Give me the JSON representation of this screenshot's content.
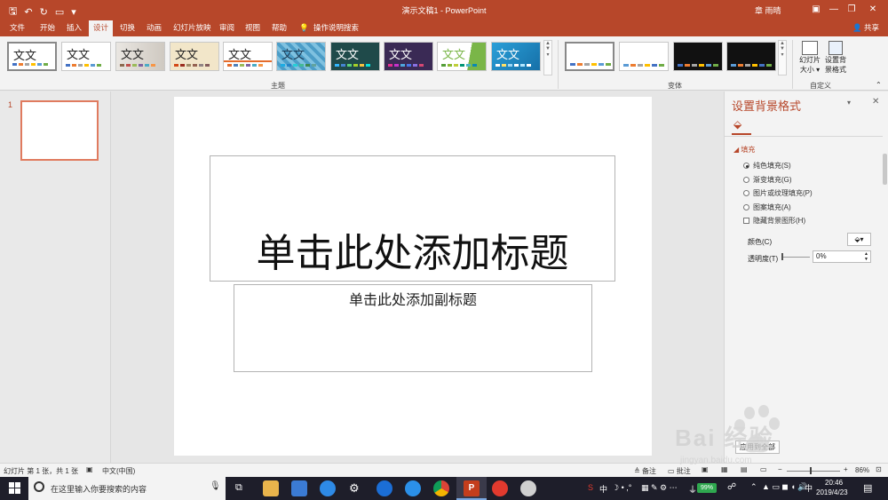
{
  "titlebar": {
    "document_title": "演示文稿1 - PowerPoint",
    "user": "章 雨晴",
    "minimize": "—",
    "restore": "❐",
    "close": "✕"
  },
  "tabs": [
    "文件",
    "开始",
    "插入",
    "设计",
    "切换",
    "动画",
    "幻灯片放映",
    "审阅",
    "视图",
    "帮助"
  ],
  "active_tab": "设计",
  "tell_me": "操作说明搜索",
  "share": "共享",
  "ribbon": {
    "themes_group": "主题",
    "variants_group": "变体",
    "customize_group": "自定义",
    "theme_label": "文文",
    "theme_label_short": "文文",
    "slide_size_line1": "幻灯片",
    "slide_size_line2": "大小 ▾",
    "format_bg_line1": "设置背",
    "format_bg_line2": "景格式",
    "themes": [
      {
        "bg": "#ffffff",
        "fg": "#222222"
      },
      {
        "bg": "#ffffff",
        "fg": "#222222"
      },
      {
        "bg": "#e8e4df",
        "fg": "#333333"
      },
      {
        "bg": "#f2e6c9",
        "fg": "#333333"
      },
      {
        "bg": "#ffffff",
        "fg": "#333333"
      },
      {
        "bg": "#5aa3c9",
        "fg": "#1b3a55"
      },
      {
        "bg": "#1f4a4a",
        "fg": "#ffffff"
      },
      {
        "bg": "#3a2a55",
        "fg": "#ffffff"
      },
      {
        "bg": "#ffffff",
        "fg": "#7ab648"
      },
      {
        "bg": "#2a9fd8",
        "fg": "#ffffff"
      }
    ],
    "variants": [
      {
        "bg": "#ffffff"
      },
      {
        "bg": "#ffffff"
      },
      {
        "bg": "#111111"
      },
      {
        "bg": "#111111"
      }
    ]
  },
  "thumbnail": {
    "number": "1"
  },
  "slide": {
    "title_placeholder": "单击此处添加标题",
    "subtitle_placeholder": "单击此处添加副标题"
  },
  "panel": {
    "title": "设置背景格式",
    "section": "填充",
    "options": [
      "纯色填充(S)",
      "渐变填充(G)",
      "图片或纹理填充(P)",
      "图案填充(A)"
    ],
    "selected_option": 0,
    "hide_graphics": "隐藏背景图形(H)",
    "color_label": "颜色(C)",
    "transparency_label": "透明度(T)",
    "transparency_value": "0%",
    "apply_all": "应用到全部"
  },
  "statusbar": {
    "slide_info": "幻灯片 第 1 张，共 1 张",
    "language": "中文(中国)",
    "notes": "备注",
    "comments": "批注",
    "zoom": "86%"
  },
  "taskbar": {
    "search_placeholder": "在这里输入你要搜索的内容",
    "ime": "中",
    "battery": "99%",
    "time": "20:46",
    "date": "2019/4/23",
    "lang": "中"
  },
  "watermark": {
    "text": "Bai 经验",
    "url": "jingyan.baidu.com"
  },
  "colors": {
    "accent": "#b7472a",
    "thumb_border": "#e07b5f"
  }
}
